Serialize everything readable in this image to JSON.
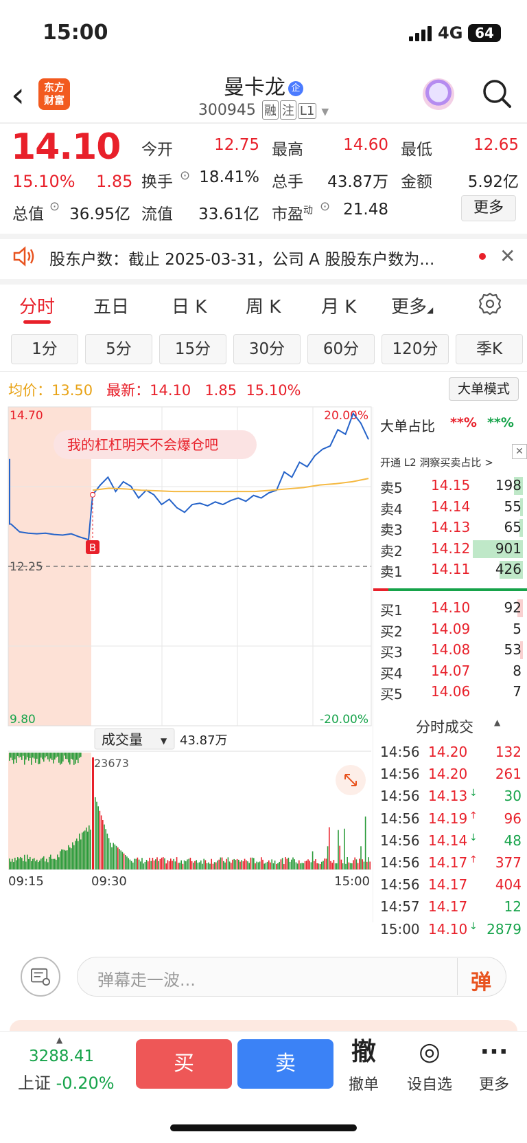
{
  "status_bar": {
    "time": "15:00",
    "network": "4G",
    "battery": "64"
  },
  "header": {
    "title": "曼卡龙",
    "title_badge": "企",
    "code": "300945",
    "tags": [
      "融",
      "注",
      "L1"
    ],
    "logo_line1": "东方",
    "logo_line2": "财富"
  },
  "quote": {
    "price": "14.10",
    "pct": "15.10%",
    "change": "1.85",
    "fields": [
      {
        "label": "今开",
        "value": "12.75",
        "color": "red"
      },
      {
        "label": "最高",
        "value": "14.60",
        "color": "red"
      },
      {
        "label": "最低",
        "value": "12.65",
        "color": "red"
      },
      {
        "label": "换手",
        "value": "18.41%",
        "color": "black"
      },
      {
        "label": "总手",
        "value": "43.87万",
        "color": "black"
      },
      {
        "label": "金额",
        "value": "5.92亿",
        "color": "black"
      },
      {
        "label": "总值",
        "value": "36.95亿",
        "color": "black"
      },
      {
        "label": "流值",
        "value": "33.61亿",
        "color": "black"
      },
      {
        "label": "市盈",
        "value": "21.48",
        "color": "black"
      }
    ],
    "pe_sup": "动",
    "more_label": "更多"
  },
  "notice": {
    "text": "股东户数：截止 2025-03-31，公司 A 股股东户数为..."
  },
  "tabs": [
    "分时",
    "五日",
    "日 K",
    "周 K",
    "月 K",
    "更多"
  ],
  "periods": [
    "1分",
    "5分",
    "15分",
    "30分",
    "60分",
    "120分",
    "季K"
  ],
  "avg_row": {
    "avg_label": "均价：",
    "avg_value": "13.50",
    "latest_label": "最新：",
    "latest_value": "14.10",
    "change": "1.85",
    "pct": "15.10%"
  },
  "big_order_mode": "大单模式",
  "chart_data": {
    "type": "line",
    "title": "",
    "y_top_label": "14.70",
    "y_mid_label": "12.25",
    "y_bottom_label": "9.80",
    "pct_top_label": "20.00%",
    "pct_bottom_label": "-20.00%",
    "ylim": [
      9.8,
      14.7
    ],
    "prev_close": 12.25,
    "x_ticks": [
      "09:15",
      "09:30",
      "15:00"
    ],
    "series": [
      {
        "values": [
          12.9,
          12.78,
          12.76,
          12.75,
          12.76,
          12.74,
          12.73,
          12.75,
          12.7,
          12.66,
          13.35,
          13.5,
          13.62,
          13.4,
          13.55,
          13.48,
          13.3,
          13.42,
          13.35,
          13.2,
          13.28,
          13.15,
          13.08,
          13.2,
          13.22,
          13.18,
          13.24,
          13.2,
          13.26,
          13.3,
          13.25,
          13.34,
          13.3,
          13.38,
          13.42,
          13.7,
          13.62,
          13.85,
          13.78,
          13.95,
          14.05,
          14.1,
          14.35,
          14.28,
          14.6,
          14.45,
          14.2
        ]
      },
      {
        "values": [
          13.42,
          13.45,
          13.44,
          13.42,
          13.41,
          13.4,
          13.4,
          13.4,
          13.4,
          13.4,
          13.4,
          13.42,
          13.44,
          13.46,
          13.5,
          13.52,
          13.55,
          13.6
        ]
      }
    ],
    "marker_label": "B",
    "annotation": "我的杠杠明天不会爆仓吧",
    "volume_label": "成交量",
    "volume_total": "43.87万",
    "volume_peak_label": "23673"
  },
  "orderbook": {
    "header_label": "大单占比",
    "header_v1": "**%",
    "header_v2": "**%",
    "promo": "开通 L2 洞察买卖占比 >",
    "asks": [
      {
        "label": "卖5",
        "price": "14.15",
        "vol": "198",
        "ratio": 0.1
      },
      {
        "label": "卖4",
        "price": "14.14",
        "vol": "55",
        "ratio": 0.03
      },
      {
        "label": "卖3",
        "price": "14.13",
        "vol": "65",
        "ratio": 0.04
      },
      {
        "label": "卖2",
        "price": "14.12",
        "vol": "901",
        "ratio": 0.56
      },
      {
        "label": "卖1",
        "price": "14.11",
        "vol": "426",
        "ratio": 0.26
      }
    ],
    "bids": [
      {
        "label": "买1",
        "price": "14.10",
        "vol": "92",
        "ratio": 0.06
      },
      {
        "label": "买2",
        "price": "14.09",
        "vol": "5",
        "ratio": 0.0
      },
      {
        "label": "买3",
        "price": "14.08",
        "vol": "53",
        "ratio": 0.03
      },
      {
        "label": "买4",
        "price": "14.07",
        "vol": "8",
        "ratio": 0.0
      },
      {
        "label": "买5",
        "price": "14.06",
        "vol": "7",
        "ratio": 0.0
      }
    ],
    "ticks_title": "分时成交",
    "ticks": [
      {
        "time": "14:56",
        "price": "14.20",
        "arrow": "",
        "vol": "132",
        "color": "red"
      },
      {
        "time": "14:56",
        "price": "14.20",
        "arrow": "",
        "vol": "261",
        "color": "red"
      },
      {
        "time": "14:56",
        "price": "14.13",
        "arrow": "↓",
        "vol": "30",
        "color": "green"
      },
      {
        "time": "14:56",
        "price": "14.19",
        "arrow": "↑",
        "vol": "96",
        "color": "red"
      },
      {
        "time": "14:56",
        "price": "14.14",
        "arrow": "↓",
        "vol": "48",
        "color": "green"
      },
      {
        "time": "14:56",
        "price": "14.17",
        "arrow": "↑",
        "vol": "377",
        "color": "red"
      },
      {
        "time": "14:56",
        "price": "14.17",
        "arrow": "",
        "vol": "404",
        "color": "red"
      },
      {
        "time": "14:57",
        "price": "14.17",
        "arrow": "",
        "vol": "12",
        "color": "green"
      },
      {
        "time": "15:00",
        "price": "14.10",
        "arrow": "↓",
        "vol": "2879",
        "color": "green"
      }
    ]
  },
  "danmu": {
    "placeholder": "弹幕走一波...",
    "button": "弹"
  },
  "bottom": {
    "index_value": "3288.41",
    "index_name": "上证",
    "index_pct": "-0.20%",
    "buy": "买",
    "sell": "卖",
    "actions": [
      {
        "icon": "撤",
        "label": "撤单"
      },
      {
        "icon": "◎",
        "label": "设自选"
      },
      {
        "icon": "···",
        "label": "更多"
      }
    ]
  },
  "colors": {
    "red": "#e8202a",
    "green": "#16a34a",
    "avg_line": "#f5b942",
    "price_line": "#2563c9",
    "premarket": "#fde1d6"
  }
}
